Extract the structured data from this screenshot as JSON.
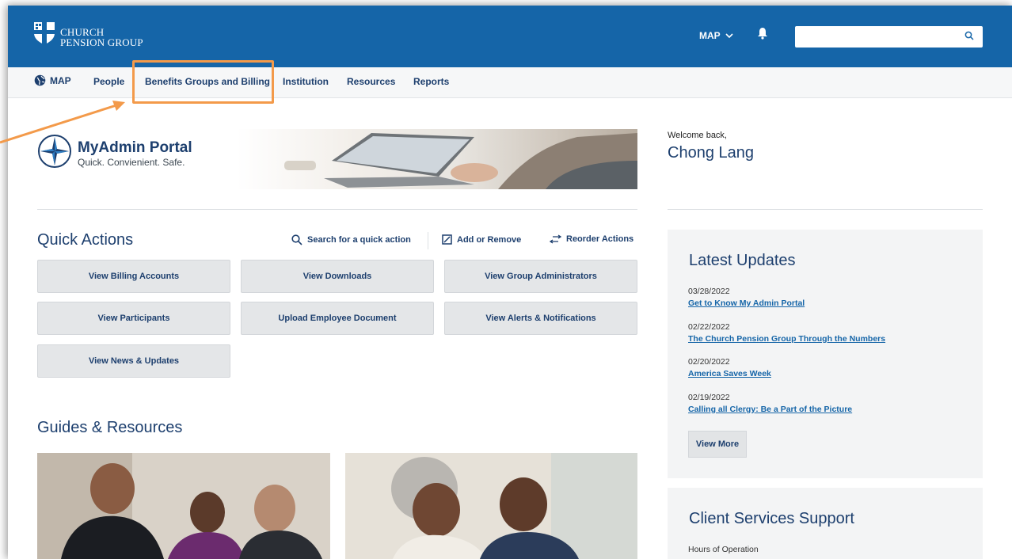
{
  "header": {
    "logo_line1": "CHURCH",
    "logo_line2": "PENSION GROUP",
    "app_menu_label": "MAP",
    "search_placeholder": "",
    "brand_color": "#1565a8"
  },
  "nav": {
    "items": [
      {
        "label": "MAP"
      },
      {
        "label": "People"
      },
      {
        "label": "Benefits Groups and Billing"
      },
      {
        "label": "Institution"
      },
      {
        "label": "Resources"
      },
      {
        "label": "Reports"
      }
    ],
    "highlight_color": "#f39a4a"
  },
  "portal": {
    "title": "MyAdmin Portal",
    "tagline": "Quick. Convienient. Safe."
  },
  "welcome": {
    "greeting": "Welcome back,",
    "name": "Chong Lang"
  },
  "quick_actions": {
    "title": "Quick Actions",
    "search_link": "Search for a quick action",
    "add_remove_link": "Add or Remove",
    "reorder_link": "Reorder Actions",
    "buttons": [
      {
        "label": "View Billing Accounts"
      },
      {
        "label": "View Downloads"
      },
      {
        "label": "View Group Administrators"
      },
      {
        "label": "View Participants"
      },
      {
        "label": "Upload Employee Document"
      },
      {
        "label": "View Alerts & Notifications"
      },
      {
        "label": "View News & Updates"
      }
    ]
  },
  "guides": {
    "title": "Guides & Resources"
  },
  "latest_updates": {
    "title": "Latest Updates",
    "items": [
      {
        "date": "03/28/2022",
        "link": "Get to Know My Admin Portal"
      },
      {
        "date": "02/22/2022",
        "link": "The Church Pension Group Through the Numbers"
      },
      {
        "date": "02/20/2022",
        "link": "America Saves Week"
      },
      {
        "date": "02/19/2022",
        "link": "Calling all Clergy: Be a Part of the Picture"
      }
    ],
    "view_more": "View More"
  },
  "client_services": {
    "title": "Client Services Support",
    "hours_label": "Hours of Operation"
  }
}
